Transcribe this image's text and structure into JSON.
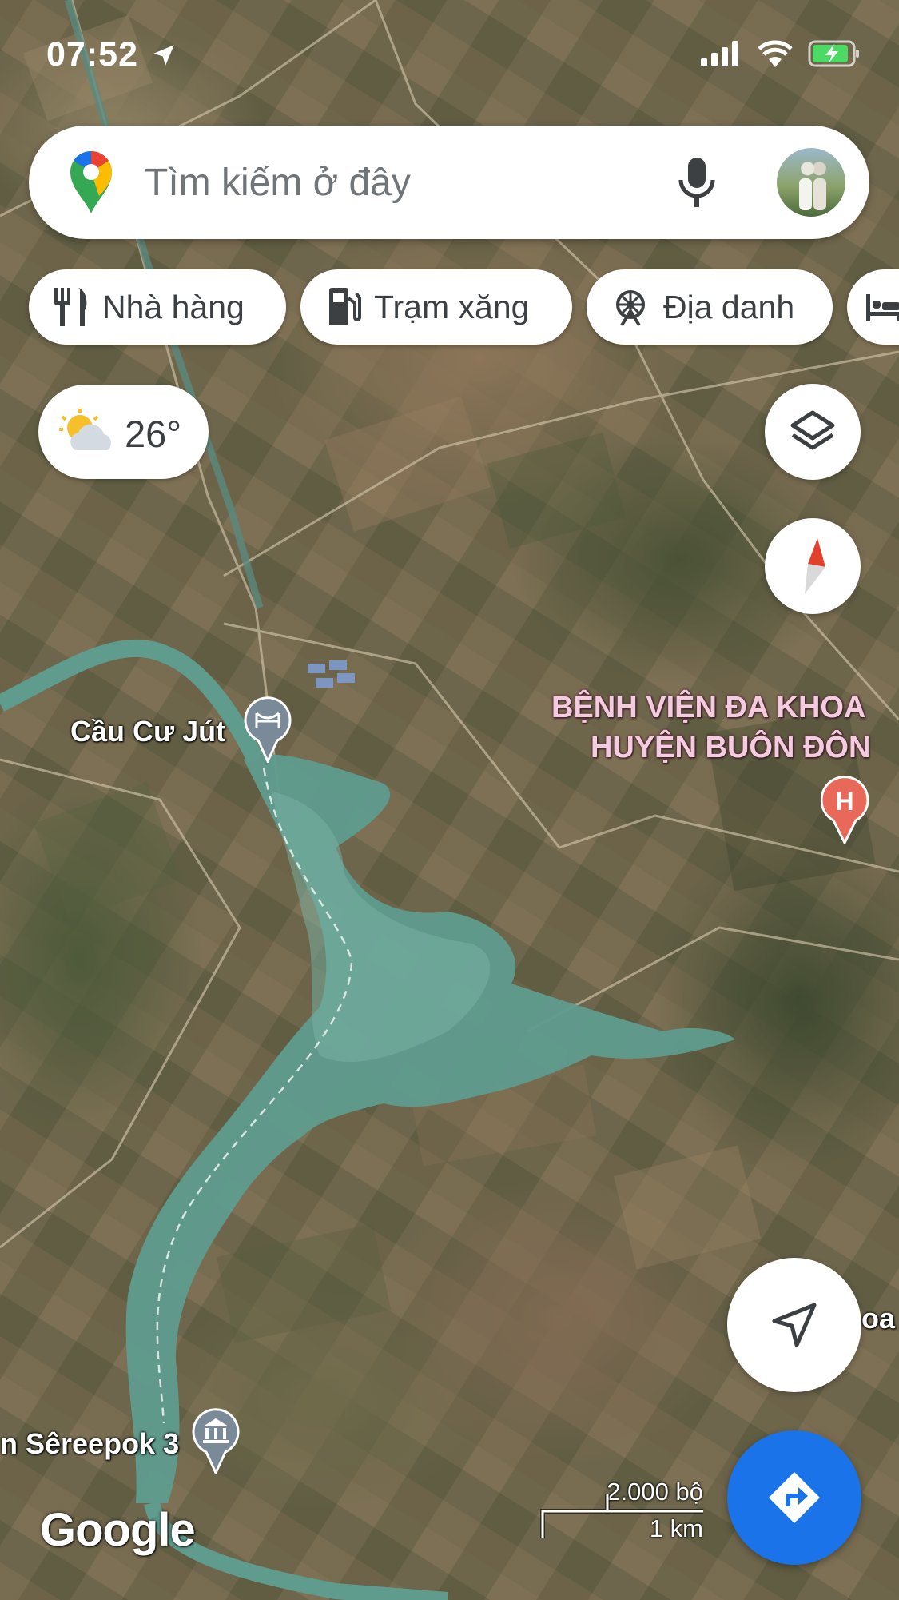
{
  "status_bar": {
    "time": "07:52",
    "icons": [
      "location-arrow-icon",
      "signal-icon",
      "wifi-icon",
      "battery-charging-icon"
    ]
  },
  "search": {
    "placeholder": "Tìm kiếm ở đây",
    "logo": "google-maps-pin-icon",
    "mic_icon": "microphone-icon"
  },
  "chips": [
    {
      "label": "Nhà hàng",
      "icon": "restaurant-icon"
    },
    {
      "label": "Trạm xăng",
      "icon": "gas-station-icon"
    },
    {
      "label": "Địa danh",
      "icon": "landmark-icon"
    },
    {
      "label": "",
      "icon": "hotel-icon"
    }
  ],
  "weather": {
    "temperature": "26°",
    "icon": "partly-cloudy-icon"
  },
  "map": {
    "labels": {
      "bridge": "Cầu Cư Jút",
      "hospital_line1": "BỆNH VIỆN ĐA KHOA",
      "hospital_line2": "HUYỆN BUÔN ĐÔN",
      "hydro": "n Sêreepok 3",
      "partial_right": "oa"
    },
    "colors": {
      "water": "#5f9c8e",
      "hospital_pin": "#e8685a",
      "place_pin": "#7a8a99",
      "hospital_label": "#f4cce0"
    }
  },
  "controls": {
    "layers_icon": "layers-icon",
    "compass_icon": "compass-icon",
    "my_location_icon": "navigation-arrow-icon",
    "directions_icon": "directions-icon"
  },
  "footer": {
    "brand": "Google",
    "scale_top": "2.000 bộ",
    "scale_bottom": "1 km"
  }
}
